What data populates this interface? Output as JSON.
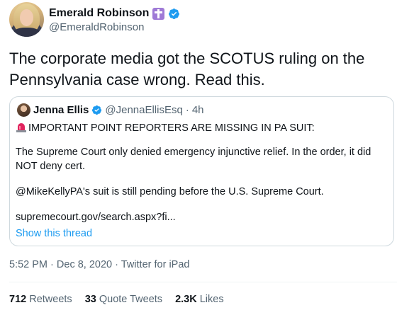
{
  "author": {
    "name": "Emerald Robinson",
    "handle": "@EmeraldRobinson",
    "badge_icon": "cross-emoji",
    "verified": true
  },
  "tweet": {
    "text": "The corporate media got the SCOTUS ruling on the Pennsylvania case wrong. Read this."
  },
  "quote": {
    "name": "Jenna Ellis",
    "handle": "@JennaEllisEsq",
    "separator": "·",
    "time": "4h",
    "verified": true,
    "headline_icon": "siren-emoji",
    "headline": "IMPORTANT POINT REPORTERS ARE MISSING IN PA SUIT:",
    "paragraph1": "The Supreme Court only denied emergency injunctive relief. In the order, it did NOT deny cert.",
    "paragraph2": "@MikeKellyPA's suit is still pending before the U.S. Supreme Court.",
    "link": "supremecourt.gov/search.aspx?fi...",
    "show_thread": "Show this thread"
  },
  "meta": {
    "time": "5:52 PM",
    "sep1": "·",
    "date": "Dec 8, 2020",
    "sep2": "·",
    "source": "Twitter for iPad"
  },
  "stats": {
    "retweets_count": "712",
    "retweets_label": "Retweets",
    "quotes_count": "33",
    "quotes_label": "Quote Tweets",
    "likes_count": "2.3K",
    "likes_label": "Likes"
  },
  "colors": {
    "accent": "#1d9bf0",
    "badge": "#9f7ad6",
    "secondary_text": "#536471",
    "border": "#cfd9de"
  }
}
